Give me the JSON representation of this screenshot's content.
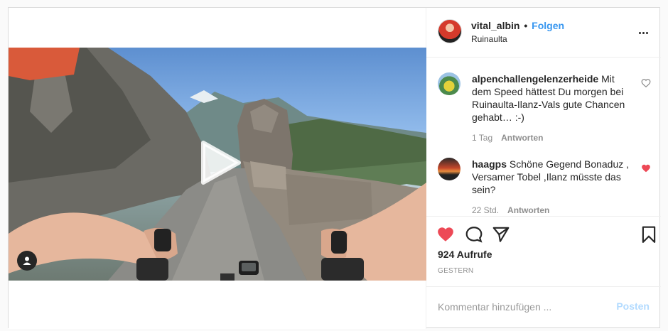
{
  "post": {
    "username": "vital_albin",
    "separator": "•",
    "follow_label": "Folgen",
    "location": "Ruinaulta"
  },
  "comments": [
    {
      "user": "alpenchallengelenzerheide",
      "text": "Mit dem Speed hättest Du morgen bei Ruinaulta-Ilanz-Vals gute Chancen gehabt… :-)",
      "time": "1 Tag",
      "reply_label": "Antworten",
      "liked": false
    },
    {
      "user": "haagps",
      "text": "Schöne Gegend Bonaduz , Versamer Tobel ,Ilanz müsste das sein?",
      "time": "22 Std.",
      "reply_label": "Antworten",
      "liked": true
    }
  ],
  "stats": {
    "views": "924 Aufrufe",
    "date": "GESTERN"
  },
  "add_comment": {
    "placeholder": "Kommentar hinzufügen ...",
    "post_label": "Posten"
  },
  "icons": {
    "like": "heart-filled-icon",
    "comment": "speech-bubble-icon",
    "share": "paper-plane-icon",
    "save": "bookmark-icon",
    "more": "ellipsis-icon",
    "play": "play-icon",
    "user_tags": "person-icon"
  },
  "colors": {
    "accent": "#3897f0",
    "like_red": "#ed4956",
    "post_disabled": "#b3dbff"
  }
}
